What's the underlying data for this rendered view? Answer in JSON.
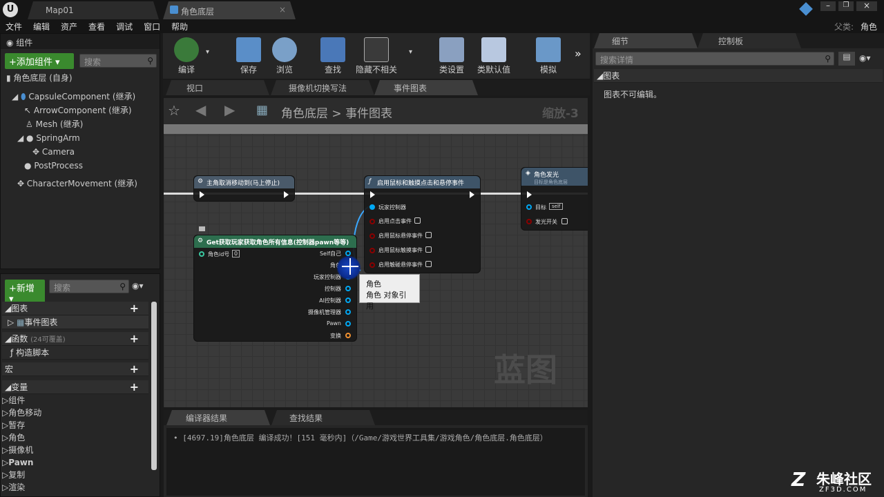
{
  "window": {
    "tabs": [
      {
        "label": "Map01"
      },
      {
        "label": "角色底层"
      }
    ],
    "parent_label": "父类:",
    "parent_value": "角色"
  },
  "menu": [
    "文件",
    "编辑",
    "资产",
    "查看",
    "调试",
    "窗口",
    "帮助"
  ],
  "components_panel": {
    "title": "组件",
    "add_button": "+添加组件",
    "search_placeholder": "搜索",
    "root": "角色底层 (自身)",
    "items": [
      "CapsuleComponent (继承)",
      "ArrowComponent (继承)",
      "Mesh (继承)",
      "SpringArm",
      "Camera",
      "PostProcess",
      "CharacterMovement (继承)"
    ]
  },
  "toolbar": {
    "buttons": [
      "编译",
      "保存",
      "浏览",
      "查找",
      "隐藏不相关",
      "类设置",
      "类默认值",
      "模拟"
    ]
  },
  "editor_tabs": [
    "视口",
    "摄像机切换写法",
    "事件图表"
  ],
  "breadcrumb": {
    "root": "角色底层",
    "sep": ">",
    "current": "事件图表",
    "zoom": "缩放-3"
  },
  "my_blueprint": {
    "new_button": "+新增",
    "search_placeholder": "搜索",
    "graphs_label": "图表",
    "event_graph": "事件图表",
    "functions_label": "函数",
    "functions_note": "(24可覆盖)",
    "construction_script": "构造脚本",
    "macros_label": "宏",
    "variables_label": "变量",
    "variable_groups": [
      "组件",
      "角色移动",
      "暂存",
      "角色",
      "摄像机",
      "Pawn",
      "复制",
      "渲染"
    ]
  },
  "graph": {
    "watermark": "蓝图",
    "node1": {
      "title": "主角取消移动到(马上停止)"
    },
    "node2": {
      "title": "启用鼠标和触摸点击和悬停事件",
      "pins": [
        "玩家控制器",
        "启用点击事件",
        "启用鼠标悬停事件",
        "启用鼠标触摸事件",
        "启用触碰悬停事件"
      ]
    },
    "node3": {
      "title": "角色发光",
      "subtitle": "目标是角色底层",
      "target_label": "目标",
      "target_value": "self",
      "toggle_label": "发光开关"
    },
    "node4": {
      "title": "Get获取玩家获取角色所有信息(控制器pawn等等)",
      "input_label": "角色id号",
      "input_value": "0",
      "outputs": [
        "Self自己",
        "角色",
        "玩家控制器",
        "控制器",
        "AI控制器",
        "摄像机管理器",
        "Pawn",
        "变换"
      ]
    },
    "tooltip": {
      "line1": "角色",
      "line2": "角色 对象引用"
    }
  },
  "details_panel": {
    "tabs": [
      "细节",
      "控制板"
    ],
    "search_placeholder": "搜索详情",
    "section": "图表",
    "message": "图表不可编辑。"
  },
  "results_panel": {
    "tabs": [
      "编译器结果",
      "查找结果"
    ],
    "log": "[4697.19]角色底层 编译成功！[151 毫秒内]（/Game/游戏世界工具集/游戏角色/角色底层.角色底层）"
  },
  "watermark_brand": {
    "line1": "朱峰社区",
    "line2": "ZF3D.COM"
  },
  "colors": {
    "accent_green": "#3a8a2e",
    "pin_blue": "#00a8f4",
    "pin_red": "#8b0000",
    "node_pure": "#2d6e4e"
  }
}
